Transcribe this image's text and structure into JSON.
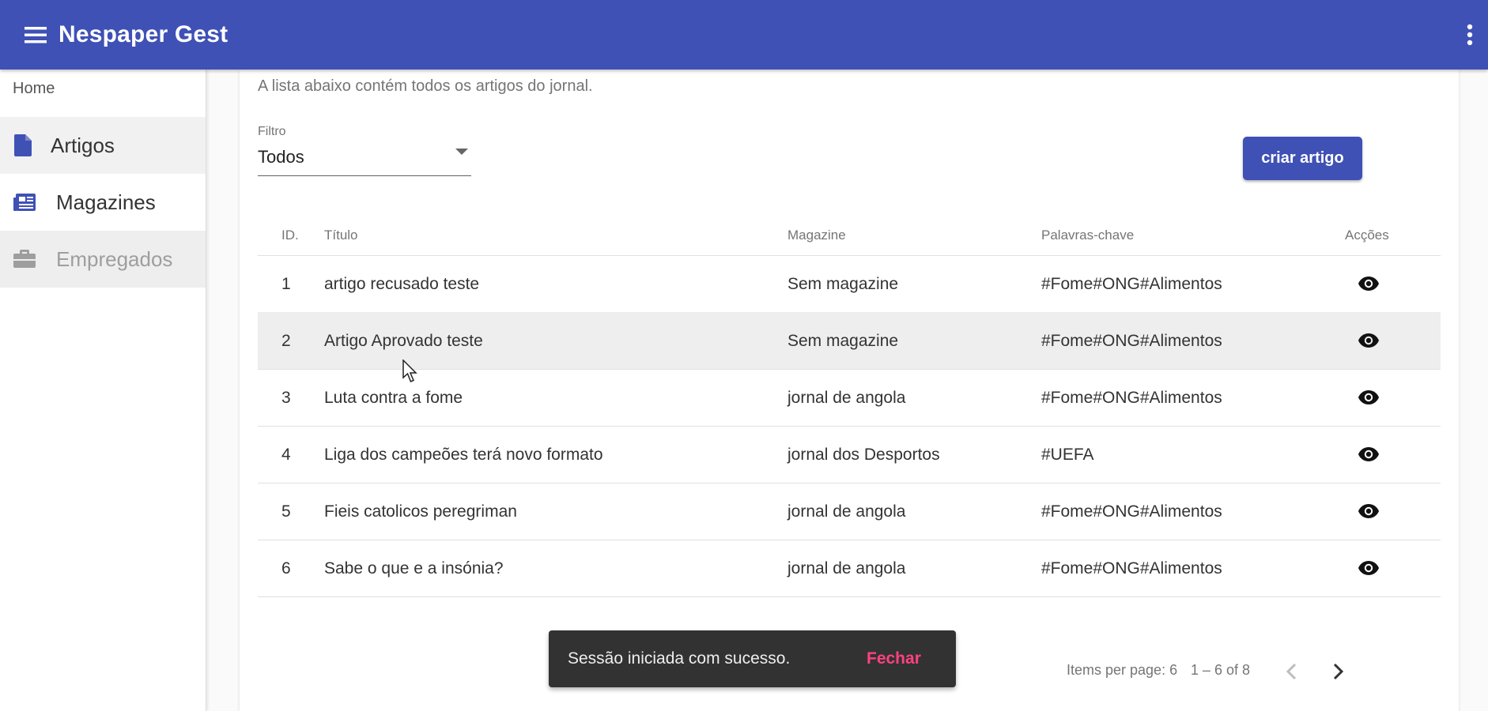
{
  "app": {
    "title": "Nespaper Gest"
  },
  "sidenav": {
    "home": "Home",
    "items": [
      {
        "label": "Artigos",
        "icon": "file-icon"
      },
      {
        "label": "Magazines",
        "icon": "newspaper-icon"
      },
      {
        "label": "Empregados",
        "icon": "briefcase-icon"
      }
    ]
  },
  "main": {
    "subtitle": "A lista abaixo contém todos os artigos do jornal.",
    "filter": {
      "label": "Filtro",
      "value": "Todos"
    },
    "create_button": "criar artigo",
    "table": {
      "headers": {
        "id": "ID.",
        "title": "Título",
        "magazine": "Magazine",
        "keywords": "Palavras-chave",
        "actions": "Acções"
      },
      "rows": [
        {
          "id": "1",
          "title": "artigo recusado teste",
          "magazine": "Sem magazine",
          "keywords": "#Fome#ONG#Alimentos"
        },
        {
          "id": "2",
          "title": "Artigo Aprovado teste",
          "magazine": "Sem magazine",
          "keywords": "#Fome#ONG#Alimentos"
        },
        {
          "id": "3",
          "title": "Luta contra a fome",
          "magazine": "jornal de angola",
          "keywords": "#Fome#ONG#Alimentos"
        },
        {
          "id": "4",
          "title": "Liga dos campeões terá novo formato",
          "magazine": "jornal dos Desportos",
          "keywords": "#UEFA"
        },
        {
          "id": "5",
          "title": "Fieis catolicos peregriman",
          "magazine": "jornal de angola",
          "keywords": "#Fome#ONG#Alimentos"
        },
        {
          "id": "6",
          "title": "Sabe o que e a insónia?",
          "magazine": "jornal de angola",
          "keywords": "#Fome#ONG#Alimentos"
        }
      ]
    },
    "paginator": {
      "items_per_page": "Items per page: 6",
      "range": "1 – 6 of 8"
    }
  },
  "snackbar": {
    "message": "Sessão iniciada com sucesso.",
    "action": "Fechar"
  },
  "colors": {
    "primary": "#3f51b5",
    "accent": "#ff4081",
    "snackbar_bg": "#323232"
  }
}
